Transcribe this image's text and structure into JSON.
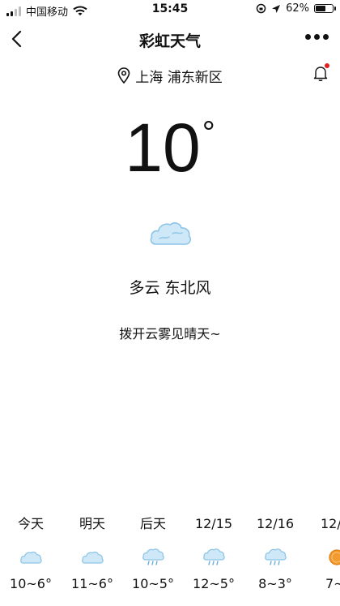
{
  "status_bar": {
    "carrier": "中国移动",
    "time": "15:45",
    "battery": "62%"
  },
  "nav": {
    "title": "彩虹天气"
  },
  "location": {
    "text": "上海 浦东新区"
  },
  "current": {
    "temperature": "10",
    "degree": "°",
    "condition": "多云 东北风",
    "slogan": "拨开云雾见晴天~",
    "icon": "cloud-icon"
  },
  "forecast": [
    {
      "day": "今天",
      "range": "10~6°",
      "icon": "cloud-icon"
    },
    {
      "day": "明天",
      "range": "11~6°",
      "icon": "cloud-icon"
    },
    {
      "day": "后天",
      "range": "10~5°",
      "icon": "light-rain-icon"
    },
    {
      "day": "12/15",
      "range": "12~5°",
      "icon": "light-rain-icon"
    },
    {
      "day": "12/16",
      "range": "8~3°",
      "icon": "light-rain-icon"
    },
    {
      "day": "12/",
      "range": "7~",
      "icon": "sun-icon"
    }
  ],
  "colors": {
    "cloud_fill": "#cfe8f7",
    "cloud_stroke": "#8cc4e6",
    "rain": "#6aaed8",
    "sun": "#f39b2e",
    "notification_dot": "#e02020"
  }
}
